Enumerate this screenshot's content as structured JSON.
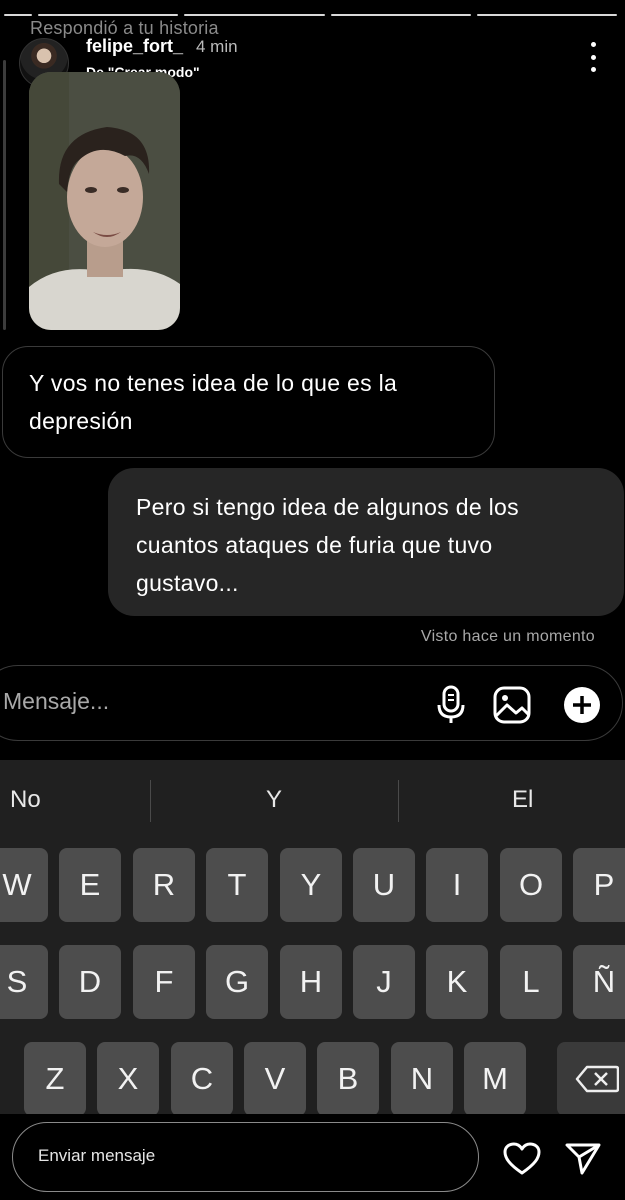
{
  "story_reply": {
    "caption": "Respondió a tu historia"
  },
  "header": {
    "username": "felipe_fort_",
    "time": "4 min",
    "subtitle": "De \"Crear modo\"",
    "more_icon": "more-vertical-icon"
  },
  "messages": [
    {
      "direction": "received",
      "text": "Y vos no tenes idea de lo que es la depresión"
    },
    {
      "direction": "sent",
      "text": "Pero si tengo idea de algunos de los cuantos ataques de furia que tuvo gustavo..."
    }
  ],
  "seen_status": "Visto hace un momento",
  "composer": {
    "placeholder": "Mensaje...",
    "icons": [
      "microphone-icon",
      "image-icon",
      "add-icon"
    ]
  },
  "keyboard": {
    "suggestions": [
      "No",
      "Y",
      "El"
    ],
    "rows": [
      [
        "W",
        "E",
        "R",
        "T",
        "Y",
        "U",
        "I",
        "O",
        "P"
      ],
      [
        "S",
        "D",
        "F",
        "G",
        "H",
        "J",
        "K",
        "L",
        "Ñ"
      ],
      [
        "Z",
        "X",
        "C",
        "V",
        "B",
        "N",
        "M"
      ]
    ],
    "backspace_icon": "backspace-icon"
  },
  "send_bar": {
    "placeholder": "Enviar mensaje",
    "icons": [
      "heart-icon",
      "send-icon"
    ]
  },
  "colors": {
    "background": "#000000",
    "sent_bubble": "#262626",
    "key": "#4d4d4d",
    "keyboard": "#202020"
  }
}
